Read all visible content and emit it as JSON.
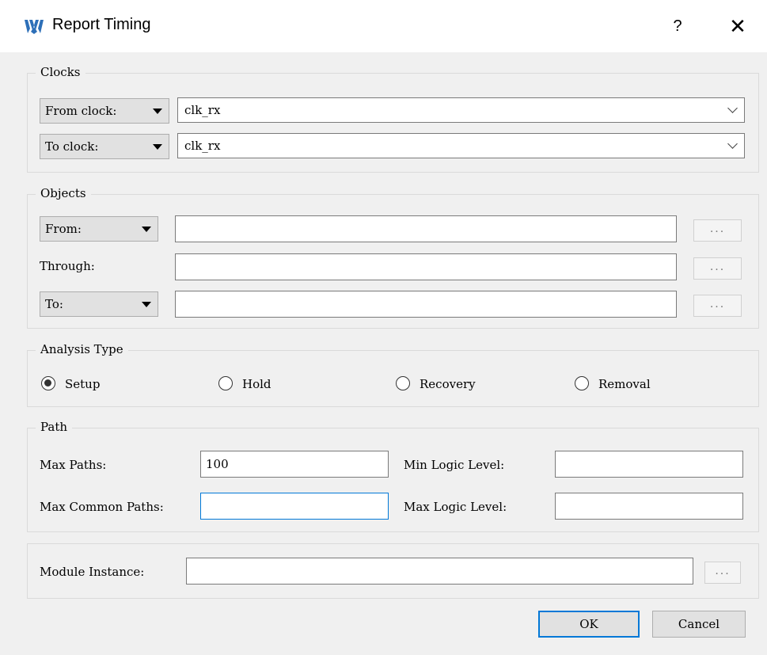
{
  "window": {
    "title": "Report Timing",
    "help": "?",
    "close": "✕",
    "icon": "gowin-logo-icon",
    "accent": "#0078d7",
    "icon_color": "#2d6fb8"
  },
  "clocks": {
    "title": "Clocks",
    "from_label": "From clock:",
    "from_value": "clk_rx",
    "to_label": "To clock:",
    "to_value": "clk_rx"
  },
  "objects": {
    "title": "Objects",
    "from_label": "From:",
    "through_label": "Through:",
    "to_label": "To:",
    "browse": "..."
  },
  "analysis": {
    "title": "Analysis Type",
    "options": [
      "Setup",
      "Hold",
      "Recovery",
      "Removal"
    ],
    "selected": "Setup"
  },
  "path": {
    "title": "Path",
    "max_paths_label": "Max Paths:",
    "max_paths_value": "100",
    "max_common_label": "Max Common Paths:",
    "max_common_value": "",
    "min_logic_label": "Min Logic Level:",
    "min_logic_value": "",
    "max_logic_label": "Max Logic Level:",
    "max_logic_value": ""
  },
  "module": {
    "label": "Module Instance:",
    "value": "",
    "browse": "..."
  },
  "buttons": {
    "ok": "OK",
    "cancel": "Cancel"
  }
}
